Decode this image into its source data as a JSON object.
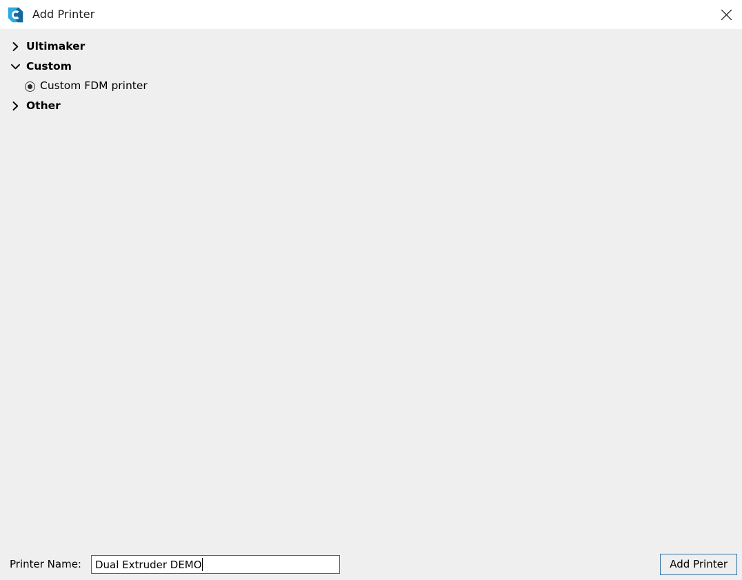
{
  "window": {
    "title": "Add Printer",
    "logo_icon": "cura-logo-icon",
    "close_icon": "close-icon",
    "colors": {
      "titlebar_bg": "#ffffff",
      "content_bg": "#efefef",
      "accent_border": "#2d6ca0",
      "logo_cyan": "#2aace2",
      "logo_blue": "#1468a0",
      "text": "#000000"
    }
  },
  "tree": {
    "groups": [
      {
        "label": "Ultimaker",
        "expanded": false,
        "chevron_icon": "chevron-right-icon",
        "children": []
      },
      {
        "label": "Custom",
        "expanded": true,
        "chevron_icon": "chevron-down-icon",
        "children": [
          {
            "label": "Custom FDM printer",
            "selected": true,
            "control_icon": "radio-button-icon"
          }
        ]
      },
      {
        "label": "Other",
        "expanded": false,
        "chevron_icon": "chevron-right-icon",
        "children": []
      }
    ]
  },
  "footer": {
    "printer_name_label": "Printer Name:",
    "printer_name_value": "Dual Extruder DEMO",
    "printer_name_placeholder": "",
    "add_printer_label": "Add Printer"
  }
}
